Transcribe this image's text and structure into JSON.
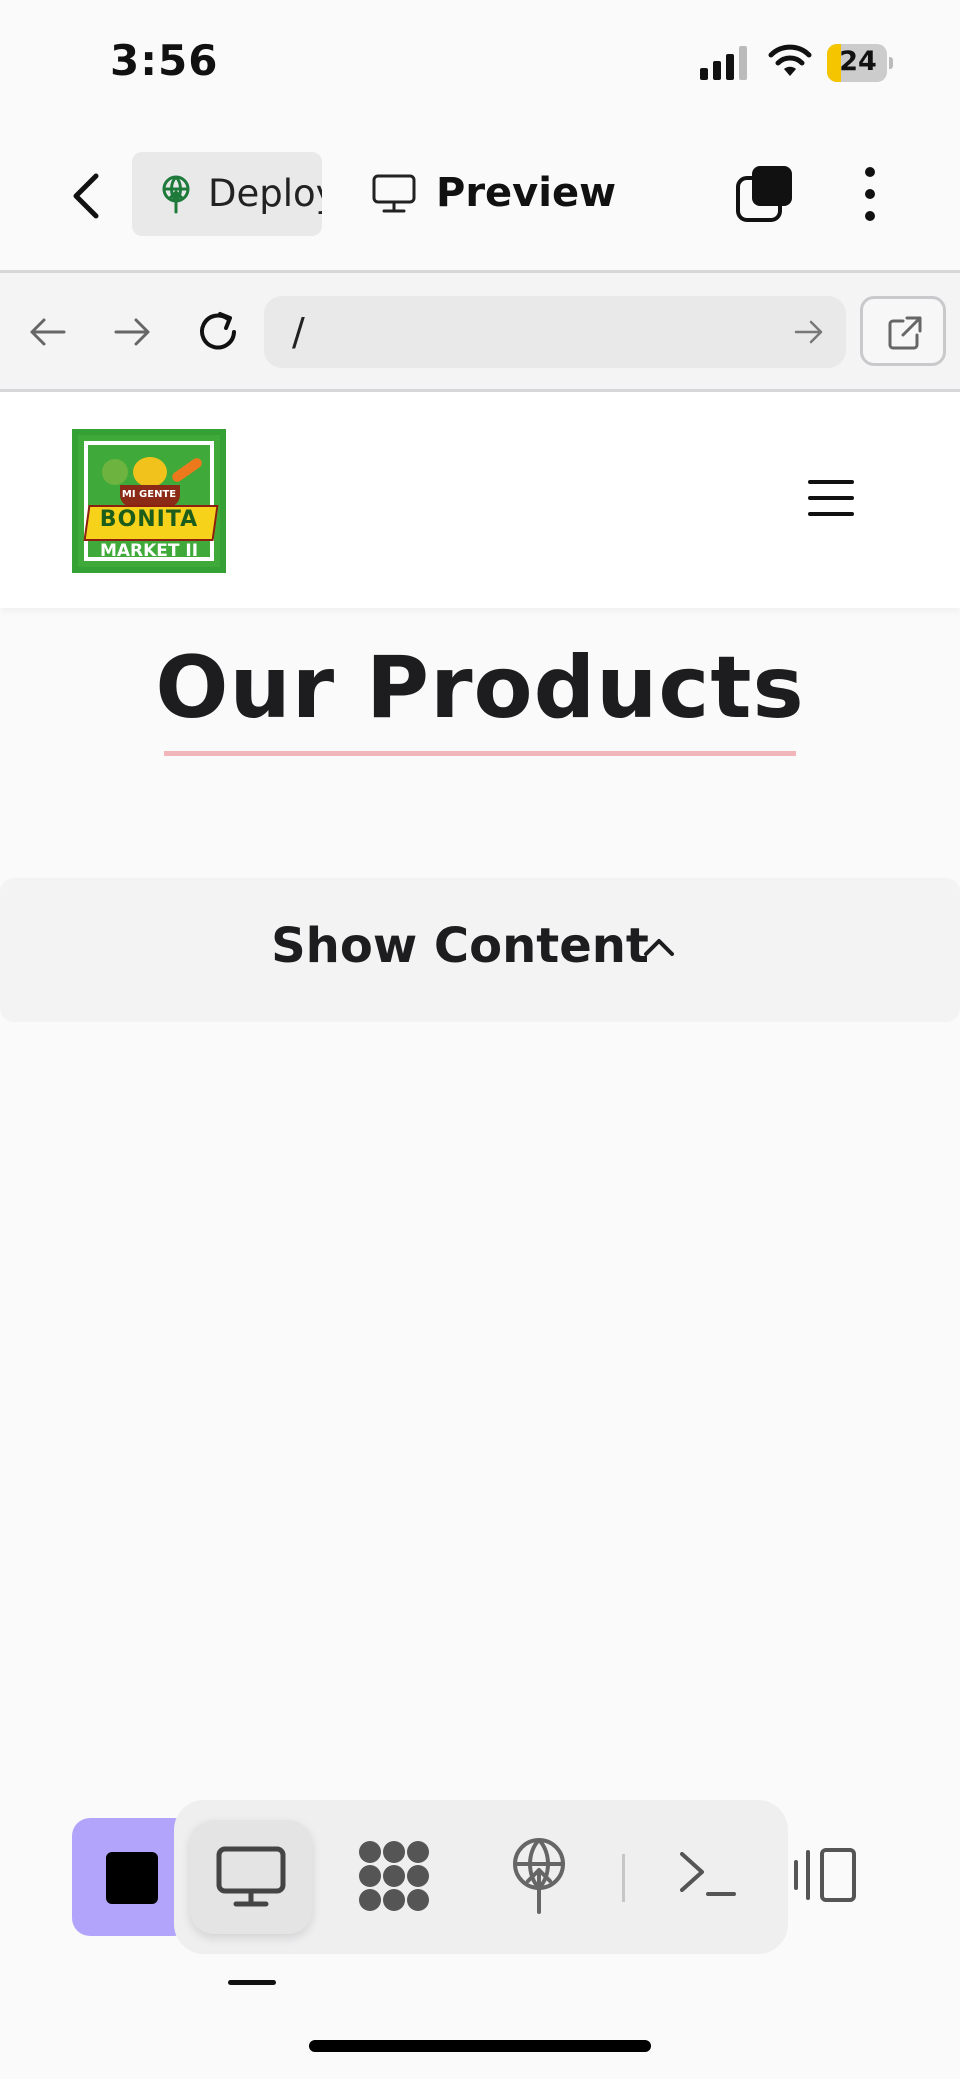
{
  "status_bar": {
    "time": "3:56",
    "battery_level": "24",
    "battery_fraction": 0.24
  },
  "app_bar": {
    "deploy_label": "Deploy",
    "preview_label": "Preview"
  },
  "browser": {
    "url": "/"
  },
  "site": {
    "logo": {
      "line1": "MI GENTE",
      "line2": "BONITA",
      "line3": "MARKET II"
    },
    "title": "Our Products",
    "show_content_label": "Show Content"
  },
  "colors": {
    "stop_button": "#b3a4fb",
    "title_underline": "#f0b6ba",
    "logo_green": "#3faa3a"
  },
  "icons": {
    "back": "chevron-left-icon",
    "deploy": "deploy-globe-icon",
    "preview": "monitor-icon",
    "layers": "layers-icon",
    "more": "more-vertical-icon",
    "nav_back": "arrow-left-icon",
    "nav_forward": "arrow-right-icon",
    "reload": "reload-icon",
    "go": "arrow-right-icon",
    "open_external": "external-link-icon",
    "menu": "hamburger-icon",
    "chevron_up": "chevron-up-icon",
    "stop": "stop-icon",
    "desktop": "monitor-icon",
    "apps": "apps-icon",
    "shell": "terminal-icon",
    "panel": "side-panel-icon"
  }
}
